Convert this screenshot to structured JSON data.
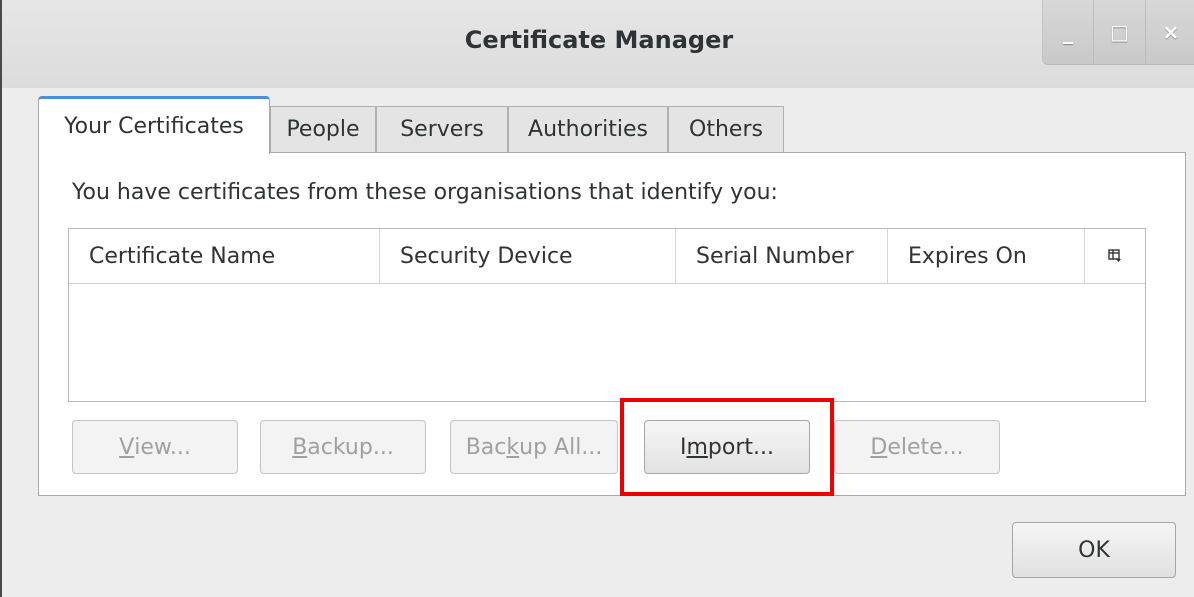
{
  "window": {
    "title": "Certificate Manager",
    "controls": {
      "minimize": "_",
      "maximize": "□",
      "close": "×"
    }
  },
  "tabs": [
    {
      "label": "Your Certificates",
      "active": true
    },
    {
      "label": "People",
      "active": false
    },
    {
      "label": "Servers",
      "active": false
    },
    {
      "label": "Authorities",
      "active": false
    },
    {
      "label": "Others",
      "active": false
    }
  ],
  "panel": {
    "description": "You have certificates from these organisations that identify you:",
    "columns": [
      "Certificate Name",
      "Security Device",
      "Serial Number",
      "Expires On"
    ],
    "column_picker_icon": "column-picker-icon",
    "rows": []
  },
  "buttons": {
    "view": {
      "pre": "",
      "mnemonic": "V",
      "post": "iew...",
      "enabled": false
    },
    "backup": {
      "pre": "",
      "mnemonic": "B",
      "post": "ackup...",
      "enabled": false
    },
    "backup_all": {
      "pre": "Bac",
      "mnemonic": "k",
      "post": "up All...",
      "enabled": false
    },
    "import": {
      "pre": "I",
      "mnemonic": "m",
      "post": "port...",
      "enabled": true
    },
    "delete": {
      "pre": "",
      "mnemonic": "D",
      "post": "elete...",
      "enabled": false
    }
  },
  "ok_label": "OK",
  "colors": {
    "highlight": "#ee0000",
    "active_tab_accent": "#4a90d9"
  }
}
